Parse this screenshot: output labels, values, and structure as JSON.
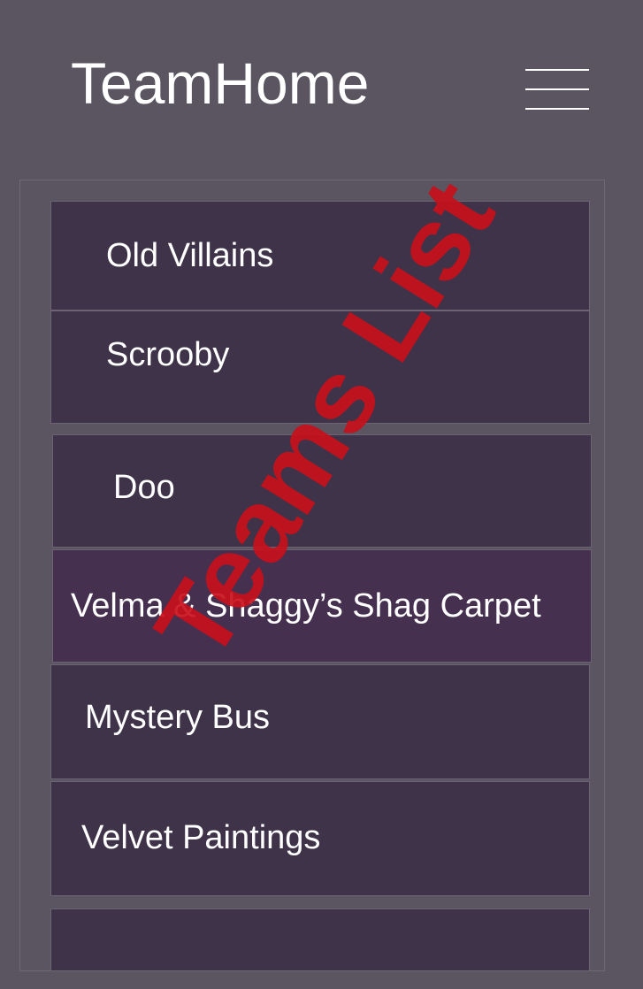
{
  "header": {
    "app_title": "TeamHome",
    "menu_icon": "hamburger-menu-icon"
  },
  "teams": [
    {
      "name": "Old Villains"
    },
    {
      "name": "Scrooby"
    },
    {
      "name": "Doo"
    },
    {
      "name": "Velma & Shaggy’s Shag Carpet"
    },
    {
      "name": "Mystery Bus"
    },
    {
      "name": "Velvet Paintings"
    },
    {
      "name": ""
    }
  ],
  "watermark": {
    "text": "Teams List",
    "color": "#c8101c"
  },
  "colors": {
    "background": "#5a5560",
    "item_background": "#3e3348",
    "item_highlight": "#46304f"
  }
}
